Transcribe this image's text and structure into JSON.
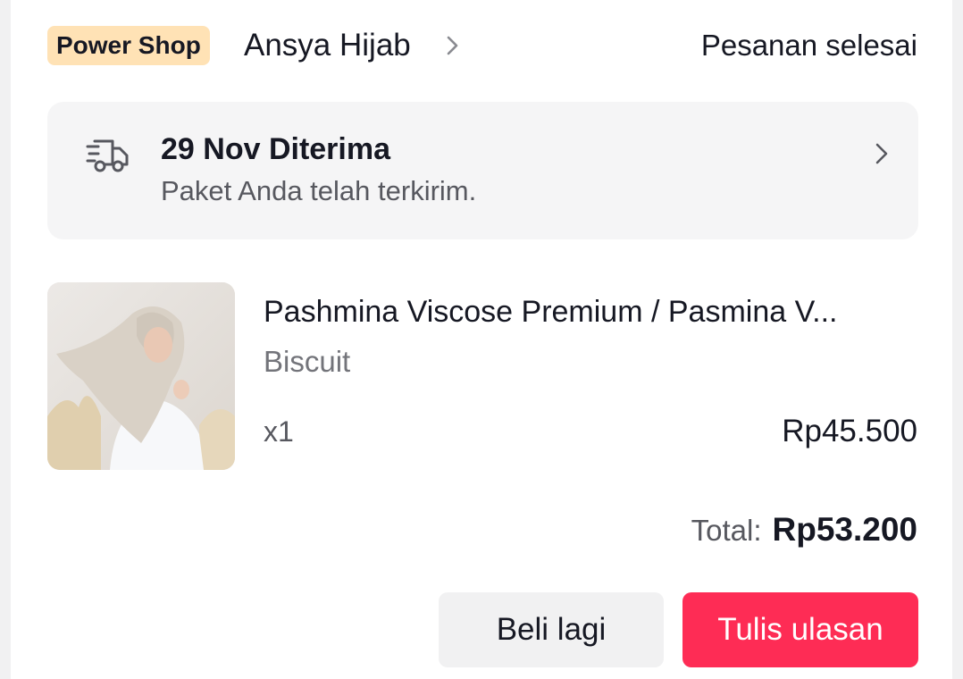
{
  "header": {
    "badge": "Power Shop",
    "shop_name": "Ansya Hijab",
    "order_status": "Pesanan selesai"
  },
  "delivery": {
    "icon": "delivery-truck-icon",
    "title": "29 Nov Diterima",
    "subtitle": "Paket Anda telah terkirim."
  },
  "product": {
    "name": "Pashmina Viscose Premium / Pasmina V...",
    "variant": "Biscuit",
    "quantity": "x1",
    "price": "Rp45.500"
  },
  "total": {
    "label": "Total:",
    "value": "Rp53.200"
  },
  "actions": {
    "buy_again": "Beli lagi",
    "write_review": "Tulis ulasan"
  },
  "colors": {
    "accent": "#fe2c55",
    "badge_bg": "#ffe2b5",
    "page_bg": "#f1f1f2"
  }
}
